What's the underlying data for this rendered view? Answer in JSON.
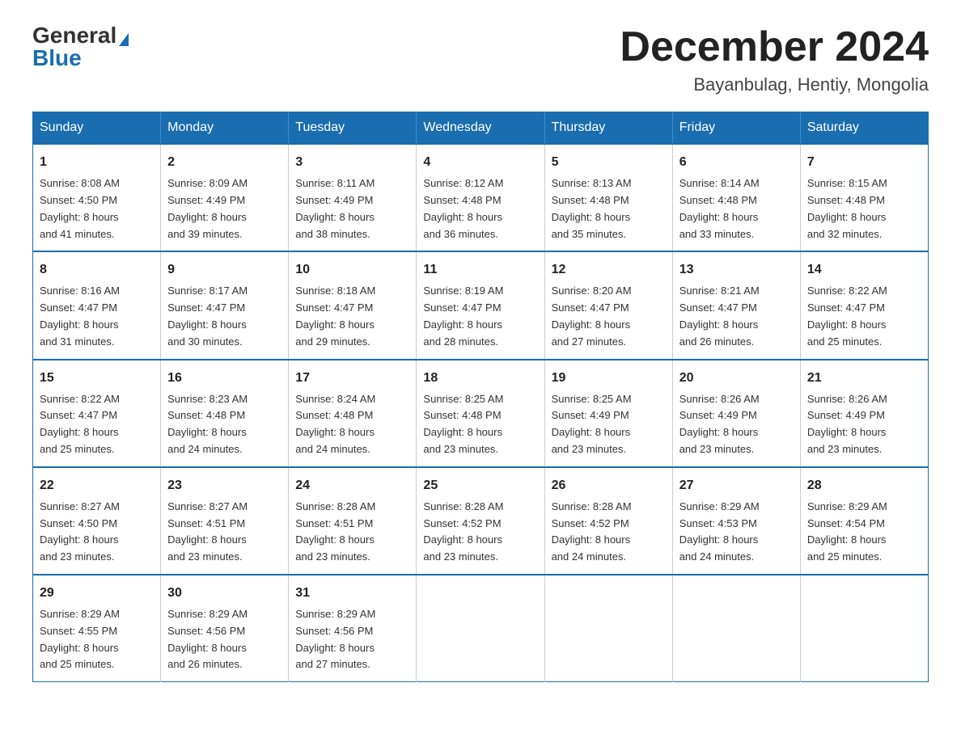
{
  "header": {
    "logo_general": "General",
    "logo_blue": "Blue",
    "month_title": "December 2024",
    "location": "Bayanbulag, Hentiy, Mongolia"
  },
  "days_of_week": [
    "Sunday",
    "Monday",
    "Tuesday",
    "Wednesday",
    "Thursday",
    "Friday",
    "Saturday"
  ],
  "weeks": [
    [
      {
        "day": "1",
        "sunrise": "8:08 AM",
        "sunset": "4:50 PM",
        "daylight": "8 hours and 41 minutes."
      },
      {
        "day": "2",
        "sunrise": "8:09 AM",
        "sunset": "4:49 PM",
        "daylight": "8 hours and 39 minutes."
      },
      {
        "day": "3",
        "sunrise": "8:11 AM",
        "sunset": "4:49 PM",
        "daylight": "8 hours and 38 minutes."
      },
      {
        "day": "4",
        "sunrise": "8:12 AM",
        "sunset": "4:48 PM",
        "daylight": "8 hours and 36 minutes."
      },
      {
        "day": "5",
        "sunrise": "8:13 AM",
        "sunset": "4:48 PM",
        "daylight": "8 hours and 35 minutes."
      },
      {
        "day": "6",
        "sunrise": "8:14 AM",
        "sunset": "4:48 PM",
        "daylight": "8 hours and 33 minutes."
      },
      {
        "day": "7",
        "sunrise": "8:15 AM",
        "sunset": "4:48 PM",
        "daylight": "8 hours and 32 minutes."
      }
    ],
    [
      {
        "day": "8",
        "sunrise": "8:16 AM",
        "sunset": "4:47 PM",
        "daylight": "8 hours and 31 minutes."
      },
      {
        "day": "9",
        "sunrise": "8:17 AM",
        "sunset": "4:47 PM",
        "daylight": "8 hours and 30 minutes."
      },
      {
        "day": "10",
        "sunrise": "8:18 AM",
        "sunset": "4:47 PM",
        "daylight": "8 hours and 29 minutes."
      },
      {
        "day": "11",
        "sunrise": "8:19 AM",
        "sunset": "4:47 PM",
        "daylight": "8 hours and 28 minutes."
      },
      {
        "day": "12",
        "sunrise": "8:20 AM",
        "sunset": "4:47 PM",
        "daylight": "8 hours and 27 minutes."
      },
      {
        "day": "13",
        "sunrise": "8:21 AM",
        "sunset": "4:47 PM",
        "daylight": "8 hours and 26 minutes."
      },
      {
        "day": "14",
        "sunrise": "8:22 AM",
        "sunset": "4:47 PM",
        "daylight": "8 hours and 25 minutes."
      }
    ],
    [
      {
        "day": "15",
        "sunrise": "8:22 AM",
        "sunset": "4:47 PM",
        "daylight": "8 hours and 25 minutes."
      },
      {
        "day": "16",
        "sunrise": "8:23 AM",
        "sunset": "4:48 PM",
        "daylight": "8 hours and 24 minutes."
      },
      {
        "day": "17",
        "sunrise": "8:24 AM",
        "sunset": "4:48 PM",
        "daylight": "8 hours and 24 minutes."
      },
      {
        "day": "18",
        "sunrise": "8:25 AM",
        "sunset": "4:48 PM",
        "daylight": "8 hours and 23 minutes."
      },
      {
        "day": "19",
        "sunrise": "8:25 AM",
        "sunset": "4:49 PM",
        "daylight": "8 hours and 23 minutes."
      },
      {
        "day": "20",
        "sunrise": "8:26 AM",
        "sunset": "4:49 PM",
        "daylight": "8 hours and 23 minutes."
      },
      {
        "day": "21",
        "sunrise": "8:26 AM",
        "sunset": "4:49 PM",
        "daylight": "8 hours and 23 minutes."
      }
    ],
    [
      {
        "day": "22",
        "sunrise": "8:27 AM",
        "sunset": "4:50 PM",
        "daylight": "8 hours and 23 minutes."
      },
      {
        "day": "23",
        "sunrise": "8:27 AM",
        "sunset": "4:51 PM",
        "daylight": "8 hours and 23 minutes."
      },
      {
        "day": "24",
        "sunrise": "8:28 AM",
        "sunset": "4:51 PM",
        "daylight": "8 hours and 23 minutes."
      },
      {
        "day": "25",
        "sunrise": "8:28 AM",
        "sunset": "4:52 PM",
        "daylight": "8 hours and 23 minutes."
      },
      {
        "day": "26",
        "sunrise": "8:28 AM",
        "sunset": "4:52 PM",
        "daylight": "8 hours and 24 minutes."
      },
      {
        "day": "27",
        "sunrise": "8:29 AM",
        "sunset": "4:53 PM",
        "daylight": "8 hours and 24 minutes."
      },
      {
        "day": "28",
        "sunrise": "8:29 AM",
        "sunset": "4:54 PM",
        "daylight": "8 hours and 25 minutes."
      }
    ],
    [
      {
        "day": "29",
        "sunrise": "8:29 AM",
        "sunset": "4:55 PM",
        "daylight": "8 hours and 25 minutes."
      },
      {
        "day": "30",
        "sunrise": "8:29 AM",
        "sunset": "4:56 PM",
        "daylight": "8 hours and 26 minutes."
      },
      {
        "day": "31",
        "sunrise": "8:29 AM",
        "sunset": "4:56 PM",
        "daylight": "8 hours and 27 minutes."
      },
      null,
      null,
      null,
      null
    ]
  ],
  "labels": {
    "sunrise": "Sunrise:",
    "sunset": "Sunset:",
    "daylight": "Daylight:"
  }
}
